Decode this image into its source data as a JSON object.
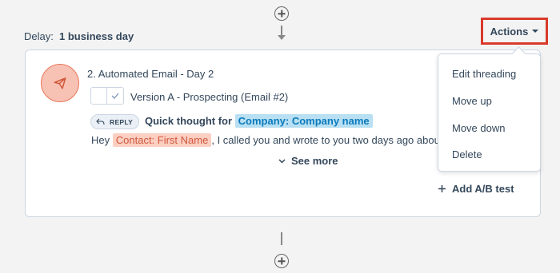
{
  "delay": {
    "label": "Delay:",
    "value": "1 business day"
  },
  "step": {
    "title": "2. Automated Email - Day 2",
    "version": "Version A - Prospecting (Email #2)",
    "reply_badge": "REPLY",
    "subject_prefix": "Quick thought for",
    "subject_token": "Company: Company name",
    "body_prefix": "Hey",
    "body_token": "Contact: First Name",
    "body_suffix": ", I called you and wrote to you two days ago about",
    "see_more": "See more",
    "add_ab": "Add A/B test"
  },
  "actions": {
    "label": "Actions",
    "menu": [
      "Edit threading",
      "Move up",
      "Move down",
      "Delete"
    ]
  },
  "colors": {
    "accent_blue": "#0b7bbd",
    "token_orange": "#d1583c",
    "highlight_red": "#d93a2c"
  }
}
